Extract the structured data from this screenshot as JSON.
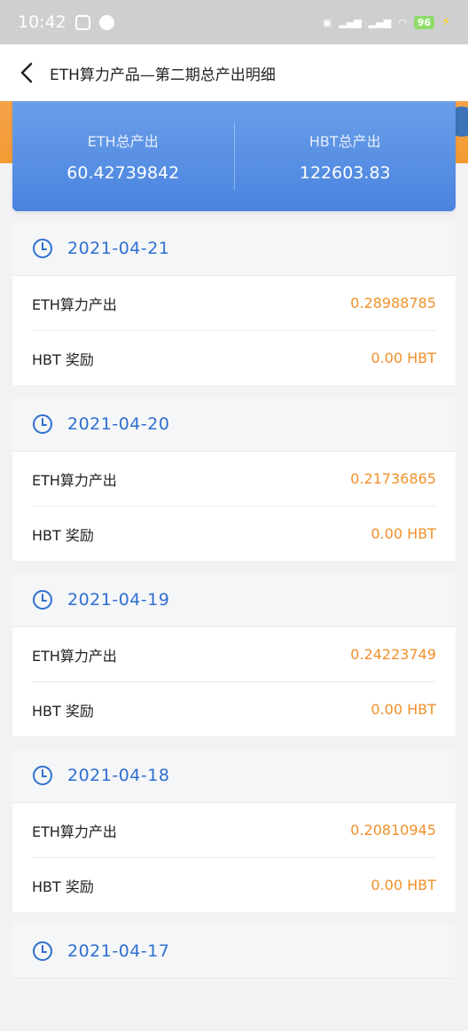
{
  "status_bar": {
    "time": "10:42",
    "battery": "96"
  },
  "header": {
    "title": "ETH算力产品—第二期总产出明细"
  },
  "summary": {
    "eth_label": "ETH总产出",
    "eth_value": "60.42739842",
    "hbt_label": "HBT总产出",
    "hbt_value": "122603.83"
  },
  "days": [
    {
      "date": "2021-04-21",
      "eth_label": "ETH算力产出",
      "eth_value": "0.28988785",
      "hbt_label": "HBT 奖励",
      "hbt_value": "0.00 HBT"
    },
    {
      "date": "2021-04-20",
      "eth_label": "ETH算力产出",
      "eth_value": "0.21736865",
      "hbt_label": "HBT 奖励",
      "hbt_value": "0.00 HBT"
    },
    {
      "date": "2021-04-19",
      "eth_label": "ETH算力产出",
      "eth_value": "0.24223749",
      "hbt_label": "HBT 奖励",
      "hbt_value": "0.00 HBT"
    },
    {
      "date": "2021-04-18",
      "eth_label": "ETH算力产出",
      "eth_value": "0.20810945",
      "hbt_label": "HBT 奖励",
      "hbt_value": "0.00 HBT"
    },
    {
      "date": "2021-04-17"
    }
  ],
  "colors": {
    "accent_blue": "#2f6fd0",
    "value_orange": "#f0902a",
    "summary_blue": "#5a90e4"
  }
}
